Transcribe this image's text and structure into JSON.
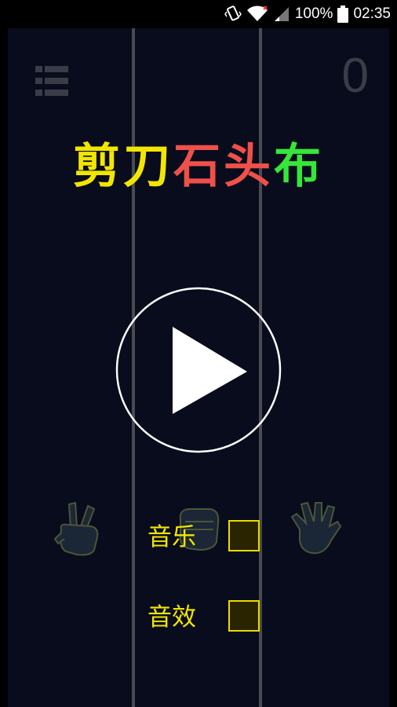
{
  "status_bar": {
    "battery_text": "100%",
    "time": "02:35",
    "icons": [
      "vibrate-icon",
      "wifi-icon",
      "signal-icon",
      "battery-icon"
    ]
  },
  "game": {
    "score": "0",
    "title": [
      {
        "text": "剪刀",
        "color": "#f2e600"
      },
      {
        "text": "石头",
        "color": "#f0504a"
      },
      {
        "text": "布",
        "color": "#36e63a"
      }
    ],
    "options": [
      {
        "label": "音乐",
        "checked": false
      },
      {
        "label": "音效",
        "checked": false
      }
    ],
    "hands": [
      "scissors-hand-icon",
      "rock-hand-icon",
      "paper-hand-icon"
    ],
    "colors": {
      "background": "#090c1c",
      "lane_line": "#4a4a52",
      "accent_yellow": "#f2e600"
    }
  }
}
